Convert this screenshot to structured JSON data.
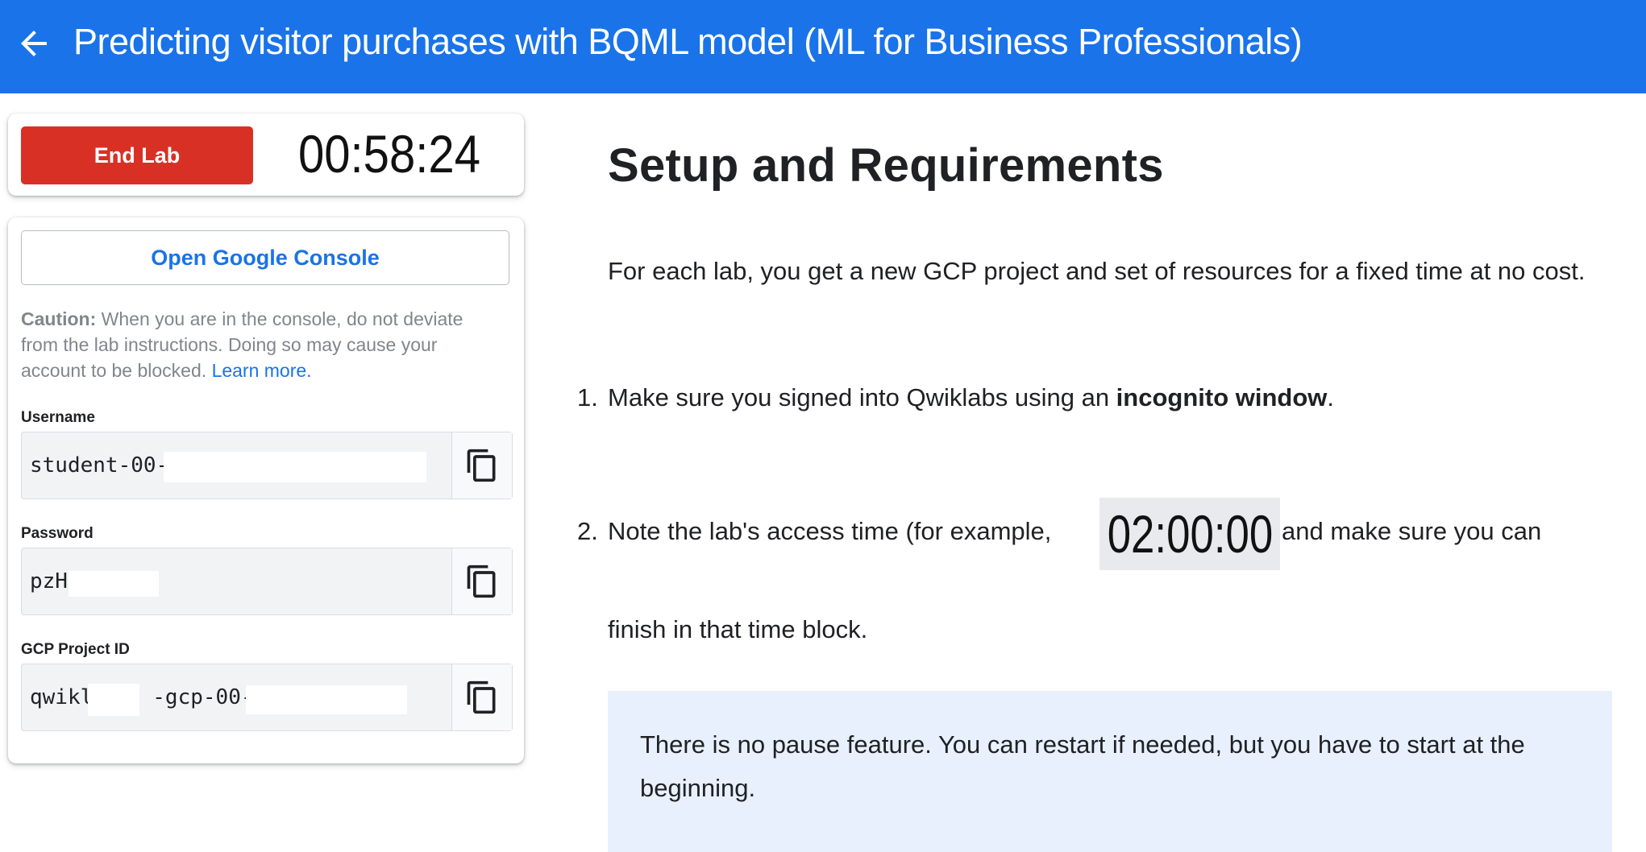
{
  "header": {
    "title": "Predicting visitor purchases with BQML model (ML for Business Professionals)",
    "back_icon": "arrow-back-icon"
  },
  "timer_card": {
    "end_lab_label": "End Lab",
    "time_remaining": "00:58:24"
  },
  "credentials": {
    "open_console_label": "Open Google Console",
    "caution_label": "Caution:",
    "caution_text": " When you are in the console, do not deviate from the lab instructions. Doing so may cause your account to be blocked. ",
    "learn_more": "Learn more.",
    "fields": [
      {
        "label": "Username",
        "value": "student-00-",
        "copy_icon": "copy-icon"
      },
      {
        "label": "Password",
        "value": "pzH",
        "copy_icon": "copy-icon"
      },
      {
        "label": "GCP Project ID",
        "value": "qwikl",
        "value_part2": "-gcp-00-8",
        "copy_icon": "copy-icon"
      }
    ]
  },
  "main": {
    "heading": "Setup and Requirements",
    "intro": "For each lab, you get a new GCP project and set of resources for a fixed time at no cost.",
    "steps": [
      {
        "num": "1.",
        "text_before": "Make sure you signed into Qwiklabs using an ",
        "bold": "incognito window",
        "text_after": "."
      },
      {
        "num": "2.",
        "text_before": "Note the lab's access time (for example, ",
        "time_example": "02:00:00",
        "text_after": " and make sure you can",
        "text_line2": "finish in that time block."
      }
    ],
    "note": "There is no pause feature. You can restart if needed, but you have to start at the beginning."
  },
  "colors": {
    "header_bg": "#1a73e8",
    "end_lab_bg": "#d93025",
    "link": "#1a73e8",
    "note_bg": "#e8f0fe"
  }
}
